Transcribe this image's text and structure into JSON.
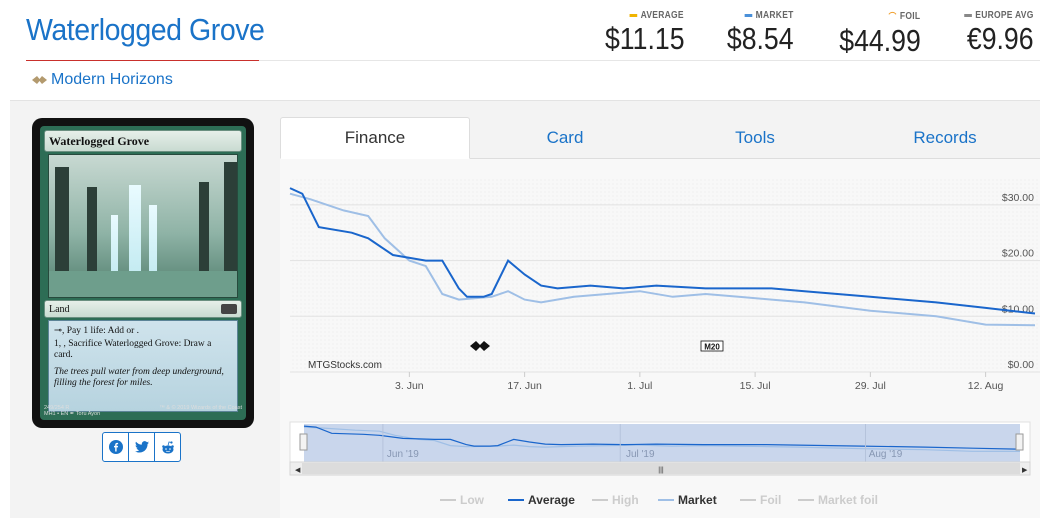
{
  "card": {
    "title": "Waterlogged Grove",
    "set_name": "Modern Horizons",
    "image": {
      "name": "Waterlogged Grove",
      "type_line": "Land",
      "rarity": "R",
      "ability1": ", Pay 1 life: Add  or .",
      "ability2": "1, , Sacrifice Waterlogged Grove: Draw a card.",
      "flavor": "The trees pull water from deep underground, filling the forest for miles.",
      "collector": "249/254 R",
      "set_lang": "MH1 • EN ✒ Toru Ayon",
      "copyright": "™ & © 2019 Wizards of the Coast"
    }
  },
  "prices": [
    {
      "label": "AVERAGE",
      "value": "$11.15",
      "color": "#f0b400"
    },
    {
      "label": "MARKET",
      "value": "$8.54",
      "color": "#4a90d9"
    },
    {
      "label": "FOIL",
      "value": "$44.99",
      "color": "#f0a030"
    },
    {
      "label": "EUROPE AVG",
      "value": "€9.96",
      "color": "#888888"
    }
  ],
  "tabs": [
    {
      "label": "Finance",
      "active": true
    },
    {
      "label": "Card",
      "active": false
    },
    {
      "label": "Tools",
      "active": false
    },
    {
      "label": "Records",
      "active": false
    }
  ],
  "share": [
    "facebook-icon",
    "twitter-icon",
    "reddit-icon"
  ],
  "chart_data": {
    "type": "line",
    "watermark": "MTGStocks.com",
    "y_tick_labels": [
      "$30.00",
      "$20.00",
      "$10.00",
      "$0.00"
    ],
    "ylim": [
      0,
      35
    ],
    "x_tick_labels": [
      "3. Jun",
      "17. Jun",
      "1. Jul",
      "15. Jul",
      "29. Jul",
      "12. Aug"
    ],
    "x_range_days": [
      -14.5,
      76
    ],
    "event_markers": [
      "set-release-icon",
      "M20"
    ],
    "navigator_labels": [
      "Jun '19",
      "Jul '19",
      "Aug '19"
    ],
    "legend": [
      {
        "name": "Low",
        "color": "#cccccc",
        "active": false
      },
      {
        "name": "Average",
        "color": "#1a66cc",
        "active": true
      },
      {
        "name": "High",
        "color": "#cccccc",
        "active": false
      },
      {
        "name": "Market",
        "color": "#9fbfe6",
        "active": true
      },
      {
        "name": "Foil",
        "color": "#cccccc",
        "active": false
      },
      {
        "name": "Market foil",
        "color": "#cccccc",
        "active": false
      }
    ],
    "series": [
      {
        "name": "Average",
        "color": "#1a66cc",
        "points": [
          [
            -14.5,
            33
          ],
          [
            -13,
            32
          ],
          [
            -11,
            26
          ],
          [
            -7,
            25
          ],
          [
            -5,
            24
          ],
          [
            -2,
            21
          ],
          [
            2,
            20
          ],
          [
            4,
            20
          ],
          [
            6,
            15
          ],
          [
            7,
            13.5
          ],
          [
            9,
            13.5
          ],
          [
            10,
            14
          ],
          [
            12,
            20
          ],
          [
            14,
            17.5
          ],
          [
            16,
            15.5
          ],
          [
            18,
            15
          ],
          [
            22,
            15.5
          ],
          [
            26,
            15
          ],
          [
            30,
            15.5
          ],
          [
            36,
            15
          ],
          [
            44,
            15
          ],
          [
            48,
            14.5
          ],
          [
            56,
            13.5
          ],
          [
            64,
            12.5
          ],
          [
            70,
            11.5
          ],
          [
            76,
            10.5
          ]
        ]
      },
      {
        "name": "Market",
        "color": "#9fbfe6",
        "points": [
          [
            -14.5,
            32
          ],
          [
            -12,
            31
          ],
          [
            -8,
            29
          ],
          [
            -5,
            28
          ],
          [
            -3,
            24
          ],
          [
            0,
            20
          ],
          [
            2,
            19
          ],
          [
            4,
            14
          ],
          [
            6,
            13
          ],
          [
            10,
            13.5
          ],
          [
            12,
            14.5
          ],
          [
            14,
            13
          ],
          [
            16,
            12.5
          ],
          [
            20,
            13.5
          ],
          [
            24,
            14
          ],
          [
            28,
            14.5
          ],
          [
            32,
            13.5
          ],
          [
            36,
            14
          ],
          [
            40,
            13.5
          ],
          [
            44,
            13
          ],
          [
            48,
            12.5
          ],
          [
            56,
            11
          ],
          [
            64,
            10
          ],
          [
            70,
            8.5
          ],
          [
            76,
            8.4
          ]
        ]
      }
    ]
  }
}
